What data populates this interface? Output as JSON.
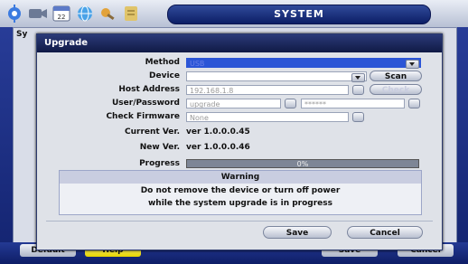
{
  "header": {
    "title": "SYSTEM"
  },
  "background": {
    "window_label": "Sy",
    "buttons": {
      "default": "Default",
      "help": "Help",
      "save": "Save",
      "cancel": "Cancel"
    }
  },
  "dialog": {
    "title": "Upgrade",
    "labels": {
      "method": "Method",
      "device": "Device",
      "host_address": "Host Address",
      "user_password": "User/Password",
      "check_firmware": "Check Firmware",
      "current_ver": "Current Ver.",
      "new_ver": "New Ver.",
      "progress": "Progress"
    },
    "method_value": "USB",
    "device_value": "",
    "scan_label": "Scan",
    "host_address_value": "192.168.1.8",
    "check_label": "Check",
    "user_value": "upgrade",
    "password_value": "******",
    "check_firmware_value": "None",
    "current_version": "ver 1.0.0.0.45",
    "new_version": "ver 1.0.0.0.46",
    "progress_text": "0%",
    "progress_fraction": 0,
    "warning": {
      "title": "Warning",
      "line1": "Do not remove the device or turn off power",
      "line2": "while the system upgrade is in progress"
    },
    "save_label": "Save",
    "cancel_label": "Cancel"
  }
}
